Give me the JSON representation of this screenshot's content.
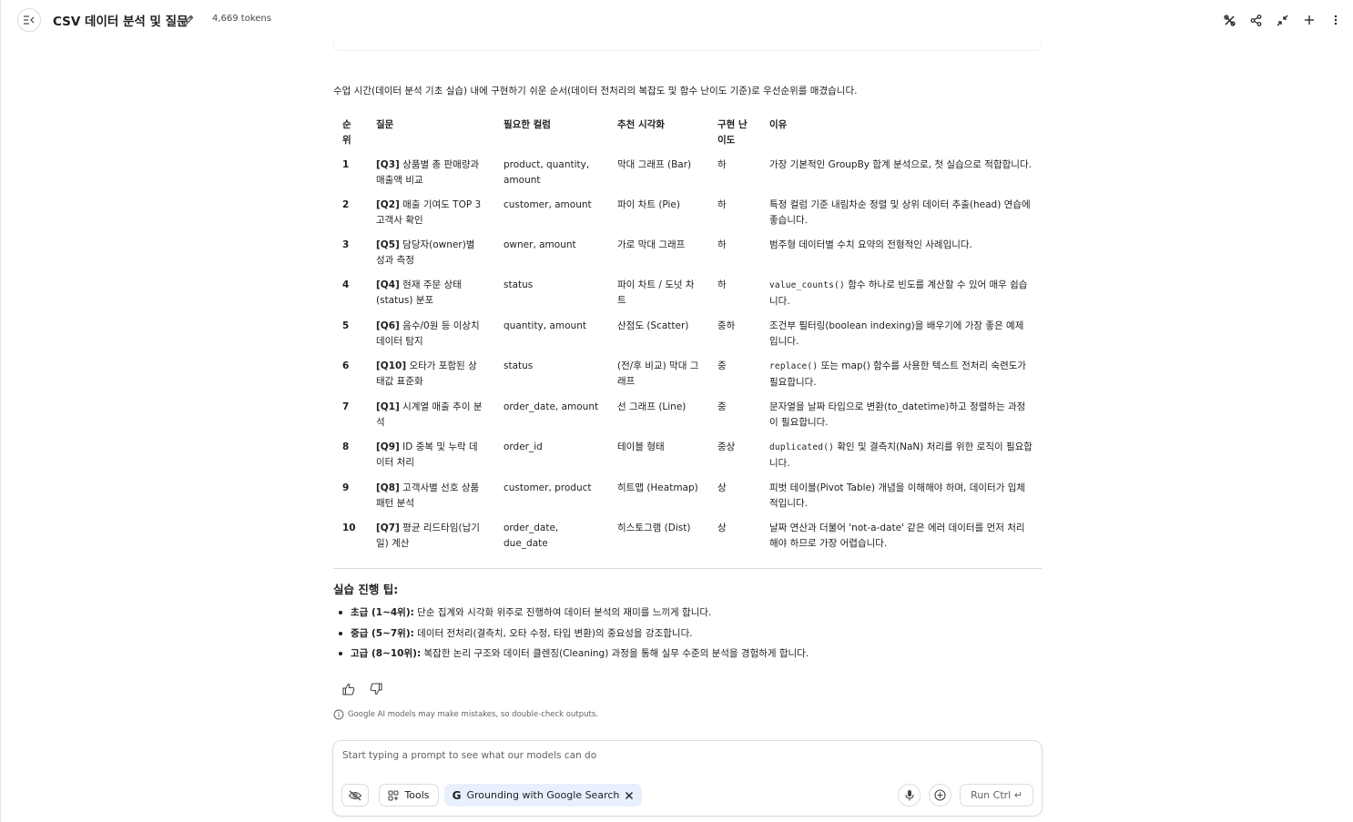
{
  "header": {
    "title": "CSV 데이터 분석 및 질문",
    "tokens": "4,669 tokens",
    "icons": [
      "compare-icon",
      "share-icon",
      "compress-icon",
      "add-icon",
      "more-icon"
    ]
  },
  "content": {
    "intro": "수업 시간(데이터 분석 기초 실습) 내에 구현하기 쉬운 순서(데이터 전처리의 복잡도 및 함수 난이도 기준)로 우선순위를 매겼습니다.",
    "table": {
      "headers": {
        "rank": "순위",
        "question": "질문",
        "columns": "필요한 컬럼",
        "viz": "추천 시각화",
        "difficulty": "구현 난이도",
        "reason": "이유"
      },
      "rows": [
        {
          "rank": "1",
          "tag": "[Q3]",
          "q": " 상품별 총 판매량과 매출액 비교",
          "cols": "product, quantity, amount",
          "viz": "막대 그래프 (Bar)",
          "diff": "하",
          "r1": "가장 기본적인 GroupBy 합계 분석으로, 첫 실습으로 적합합니다.",
          "code": "",
          "r2": ""
        },
        {
          "rank": "2",
          "tag": "[Q2]",
          "q": " 매출 기여도 TOP 3 고객사 확인",
          "cols": "customer, amount",
          "viz": "파이 차트 (Pie)",
          "diff": "하",
          "r1": "특정 컬럼 기준 내림차순 정렬 및 상위 데이터 추출(head) 연습에 좋습니다.",
          "code": "",
          "r2": ""
        },
        {
          "rank": "3",
          "tag": "[Q5]",
          "q": " 담당자(owner)별 성과 측정",
          "cols": "owner, amount",
          "viz": "가로 막대 그래프",
          "diff": "하",
          "r1": "범주형 데이터별 수치 요약의 전형적인 사례입니다.",
          "code": "",
          "r2": ""
        },
        {
          "rank": "4",
          "tag": "[Q4]",
          "q": " 현재 주문 상태(status) 분포",
          "cols": "status",
          "viz": "파이 차트 / 도넛 차트",
          "diff": "하",
          "r1": "",
          "code": "value_counts()",
          "r2": " 함수 하나로 빈도를 계산할 수 있어 매우 쉽습니다."
        },
        {
          "rank": "5",
          "tag": "[Q6]",
          "q": " 음수/0원 등 이상치 데이터 탐지",
          "cols": "quantity, amount",
          "viz": "산점도 (Scatter)",
          "diff": "중하",
          "r1": "조건부 필터링(boolean indexing)을 배우기에 가장 좋은 예제입니다.",
          "code": "",
          "r2": ""
        },
        {
          "rank": "6",
          "tag": "[Q10]",
          "q": " 오타가 포함된 상태값 표준화",
          "cols": "status",
          "viz": "(전/후 비교) 막대 그래프",
          "diff": "중",
          "r1": "",
          "code": "replace()",
          "r2": " 또는 map() 함수를 사용한 텍스트 전처리 숙련도가 필요합니다."
        },
        {
          "rank": "7",
          "tag": "[Q1]",
          "q": " 시계열 매출 추이 분석",
          "cols": "order_date, amount",
          "viz": "선 그래프 (Line)",
          "diff": "중",
          "r1": "문자열을 날짜 타입으로 변환(to_datetime)하고 정렬하는 과정이 필요합니다.",
          "code": "",
          "r2": ""
        },
        {
          "rank": "8",
          "tag": "[Q9]",
          "q": " ID 중복 및 누락 데이터 처리",
          "cols": "order_id",
          "viz": "테이블 형태",
          "diff": "중상",
          "r1": "",
          "code": "duplicated()",
          "r2": " 확인 및 결측치(NaN) 처리를 위한 로직이 필요합니다."
        },
        {
          "rank": "9",
          "tag": "[Q8]",
          "q": " 고객사별 선호 상품 패턴 분석",
          "cols": "customer, product",
          "viz": "히트맵 (Heatmap)",
          "diff": "상",
          "r1": "피벗 테이블(Pivot Table) 개념을 이해해야 하며, 데이터가 입체적입니다.",
          "code": "",
          "r2": ""
        },
        {
          "rank": "10",
          "tag": "[Q7]",
          "q": " 평균 리드타임(납기일) 계산",
          "cols": "order_date, due_date",
          "viz": "히스토그램 (Dist)",
          "diff": "상",
          "r1": "날짜 연산과 더불어 'not-a-date' 같은 에러 데이터를 먼저 처리해야 하므로 가장 어렵습니다.",
          "code": "",
          "r2": ""
        }
      ]
    },
    "tips_title": "실습 진행 팁:",
    "tips": [
      {
        "label": "초급 (1~4위):",
        "text": " 단순 집계와 시각화 위주로 진행하여 데이터 분석의 재미를 느끼게 합니다."
      },
      {
        "label": "중급 (5~7위):",
        "text": " 데이터 전처리(결측치, 오타 수정, 타입 변환)의 중요성을 강조합니다."
      },
      {
        "label": "고급 (8~10위):",
        "text": " 복잡한 논리 구조와 데이터 클렌징(Cleaning) 과정을 통해 실무 수준의 분석을 경험하게 합니다."
      }
    ],
    "disclaimer": "Google AI models may make mistakes, so double-check outputs."
  },
  "prompt": {
    "placeholder": "Start typing a prompt to see what our models can do",
    "value": "",
    "tools_label": "Tools",
    "grounding_label": "Grounding with Google Search",
    "run_label": "Run Ctrl ↵"
  }
}
